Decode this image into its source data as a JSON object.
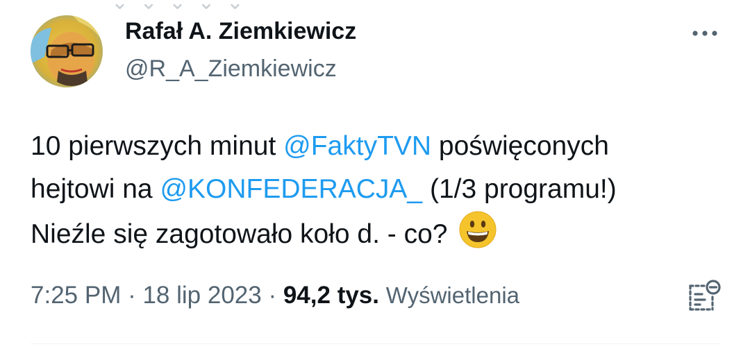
{
  "tweet": {
    "author": {
      "display_name": "Rafał A. Ziemkiewicz",
      "handle": "@R_A_Ziemkiewicz"
    },
    "text_lines": [
      [
        {
          "type": "text",
          "value": "10 pierwszych minut "
        },
        {
          "type": "mention",
          "value": "@FaktyTVN"
        },
        {
          "type": "text",
          "value": " poświęconych"
        }
      ],
      [
        {
          "type": "text",
          "value": "hejtowi na "
        },
        {
          "type": "mention",
          "value": "@KONFEDERACJA_"
        },
        {
          "type": "text",
          "value": " (1/3 programu!)"
        }
      ],
      [
        {
          "type": "text",
          "value": "Nieźle się zagotowało koło d. - co? "
        },
        {
          "type": "emoji",
          "value": "grinning-face"
        }
      ]
    ],
    "meta": {
      "time": "7:25 PM",
      "separator": " · ",
      "date": "18 lip 2023",
      "views_count": "94,2 tys.",
      "views_label": "Wyświetlenia"
    }
  },
  "icons": {
    "more": "more-horizontal-icon",
    "analytics": "bookmark-analytics-icon"
  },
  "colors": {
    "text": "#0f1419",
    "secondary": "#536471",
    "link": "#1d9bf0",
    "divider": "#eff3f4"
  }
}
